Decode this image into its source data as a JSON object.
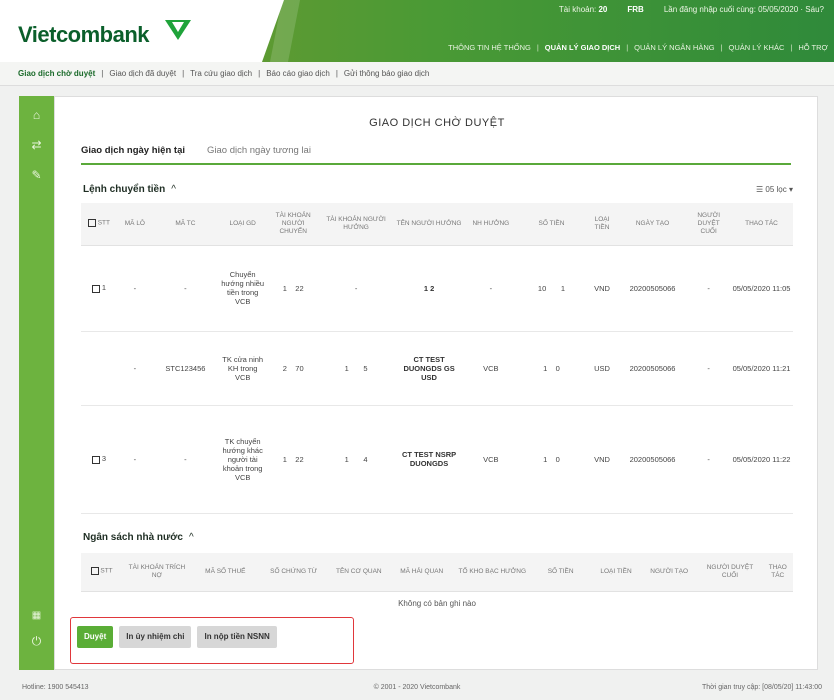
{
  "brand": {
    "name": "Vietcombank",
    "colors": {
      "green": "#6db33f",
      "dark_green": "#0b5f2b",
      "highlight": "#e0373b"
    }
  },
  "header": {
    "top": [
      {
        "label": "Tài khoản: ",
        "value": "20"
      },
      {
        "label": "",
        "value": "FRB"
      },
      {
        "label": "Lần đăng nhập cuối cùng: ",
        "value": "05/05/2020 · Sáu?"
      }
    ],
    "nav": [
      "THÔNG TIN HỆ THỐNG",
      "QUẢN LÝ GIAO DỊCH",
      "QUẢN LÝ NGÂN HÀNG",
      "QUẢN LÝ KHÁC",
      "HỖ TRỢ"
    ],
    "nav_active": 1
  },
  "submenu": [
    "Giao dịch chờ duyệt",
    "Giao dịch đã duyệt",
    "Tra cứu giao dịch",
    "Báo cáo giao dịch",
    "Gửi thông báo giao dịch"
  ],
  "sidebar_icons": [
    "home-icon",
    "transfer-icon",
    "tools-icon"
  ],
  "sidebar_bottom_icons": [
    "language-flag-icon",
    "power-icon"
  ],
  "page": {
    "title": "GIAO DỊCH CHỜ DUYỆT",
    "tabs": [
      "Giao dịch ngày hiện tại",
      "Giao dịch ngày tương lai"
    ],
    "filter": "05 lọc",
    "transfer": {
      "title": "Lệnh chuyển tiền",
      "chevron": "^",
      "columns": [
        "STT",
        "MÃ LÔ",
        "MÃ TC",
        "LOẠI GD",
        "TÀI KHOẢN NGƯỜI CHUYỂN",
        "TÀI KHOẢN NGƯỜI HƯỞNG",
        "TÊN NGƯỜI HƯỞNG",
        "NH HƯỞNG",
        "SỐ TIỀN",
        "LOẠI TIỀN",
        "NGÀY TẠO",
        "NGƯỜI DUYỆT CUỐI",
        "THAO TÁC"
      ],
      "rows": [
        {
          "stt": "1",
          "ma_lo": "-",
          "ma_tc": "-",
          "loai": "Chuyển hướng nhiều tiền trong VCB",
          "tk_chuyen": "1",
          "tk_chuyen2": "22",
          "tk_huong": "-",
          "tk_huong2": "",
          "ten": "1 2",
          "nh": "-",
          "so_tien": "10",
          "so_tien2": "1",
          "loai_tien": "VND",
          "ngay": "20200505066",
          "nguoi_duyet": "-",
          "thao_tac": "05/05/2020 11:05",
          "checkbox": true
        },
        {
          "stt": "",
          "ma_lo": "-",
          "ma_tc": "STC123456",
          "loai": "TK cửa ninh KH trong VCB",
          "tk_chuyen": "2",
          "tk_chuyen2": "70",
          "tk_huong": "1",
          "tk_huong2": "5",
          "ten": "CT TEST DUONGDS GS USD",
          "nh": "VCB",
          "so_tien": "1",
          "so_tien2": "0",
          "loai_tien": "USD",
          "ngay": "20200505066",
          "nguoi_duyet": "-",
          "thao_tac": "05/05/2020 11:21",
          "checkbox": false
        },
        {
          "stt": "3",
          "ma_lo": "-",
          "ma_tc": "-",
          "loai": "TK chuyển hướng khác người tài khoản trong VCB",
          "tk_chuyen": "1",
          "tk_chuyen2": "22",
          "tk_huong": "1",
          "tk_huong2": "4",
          "ten": "CT TEST NSRP DUONGDS",
          "nh": "VCB",
          "so_tien": "1",
          "so_tien2": "0",
          "loai_tien": "VND",
          "ngay": "20200505066",
          "nguoi_duyet": "-",
          "thao_tac": "05/05/2020 11:22",
          "checkbox": true
        }
      ]
    },
    "budget": {
      "title": "Ngân sách nhà nước",
      "chevron": "^",
      "columns": [
        "STT",
        "TÀI KHOẢN TRÍCH NỢ",
        "MÃ SỐ THUẾ",
        "SỐ CHỨNG TỪ",
        "TÊN CƠ QUAN",
        "MÃ HẢI QUAN",
        "TỔ KHO BẠC HƯỞNG",
        "SỐ TIỀN",
        "LOẠI TIỀN",
        "NGƯỜI TẠO",
        "NGƯỜI DUYỆT CUỐI",
        "THAO TÁC"
      ],
      "empty": "Không có bản ghi nào"
    },
    "buttons": {
      "approve": "Duyệt",
      "print_order": "In ủy nhiệm chi",
      "print_budget": "In nộp tiền NSNN"
    }
  },
  "footer": {
    "left": "Hotline: 1900 545413",
    "center": "© 2001 - 2020 Vietcombank",
    "right": "Thời gian truy cập: [08/05/20] 11:43:00"
  }
}
